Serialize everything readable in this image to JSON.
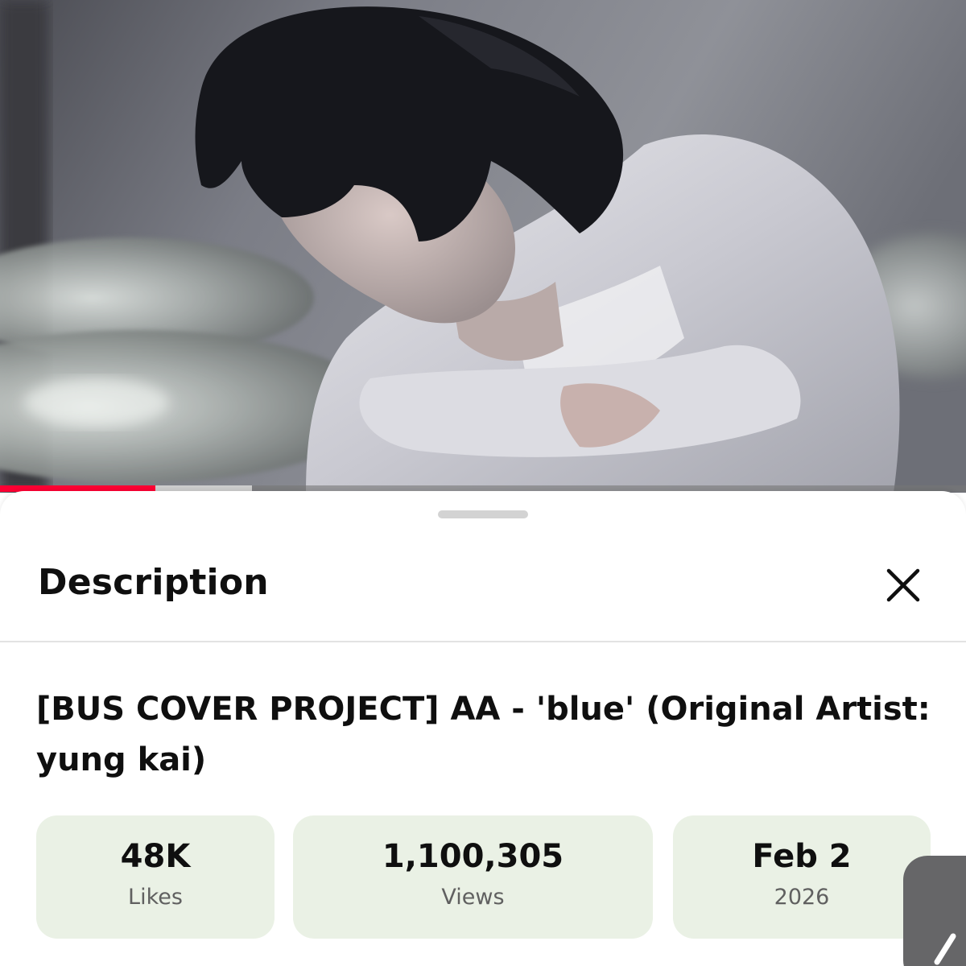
{
  "playback": {
    "played_fraction": 0.161,
    "buffered_fraction": 0.261,
    "played_color": "#ff0033"
  },
  "sheet": {
    "title": "Description",
    "close_icon": "close-icon"
  },
  "video": {
    "title": "[BUS COVER PROJECT] AA - 'blue' (Original Artist: yung kai)"
  },
  "stats": {
    "likes": {
      "value": "48K",
      "label": "Likes"
    },
    "views": {
      "value": "1,100,305",
      "label": "Views"
    },
    "date": {
      "value": "Feb 2",
      "label": "2026"
    }
  },
  "colors": {
    "card_background": "#eaf1e5",
    "text_primary": "#0f0f0f",
    "text_secondary": "#606060"
  }
}
